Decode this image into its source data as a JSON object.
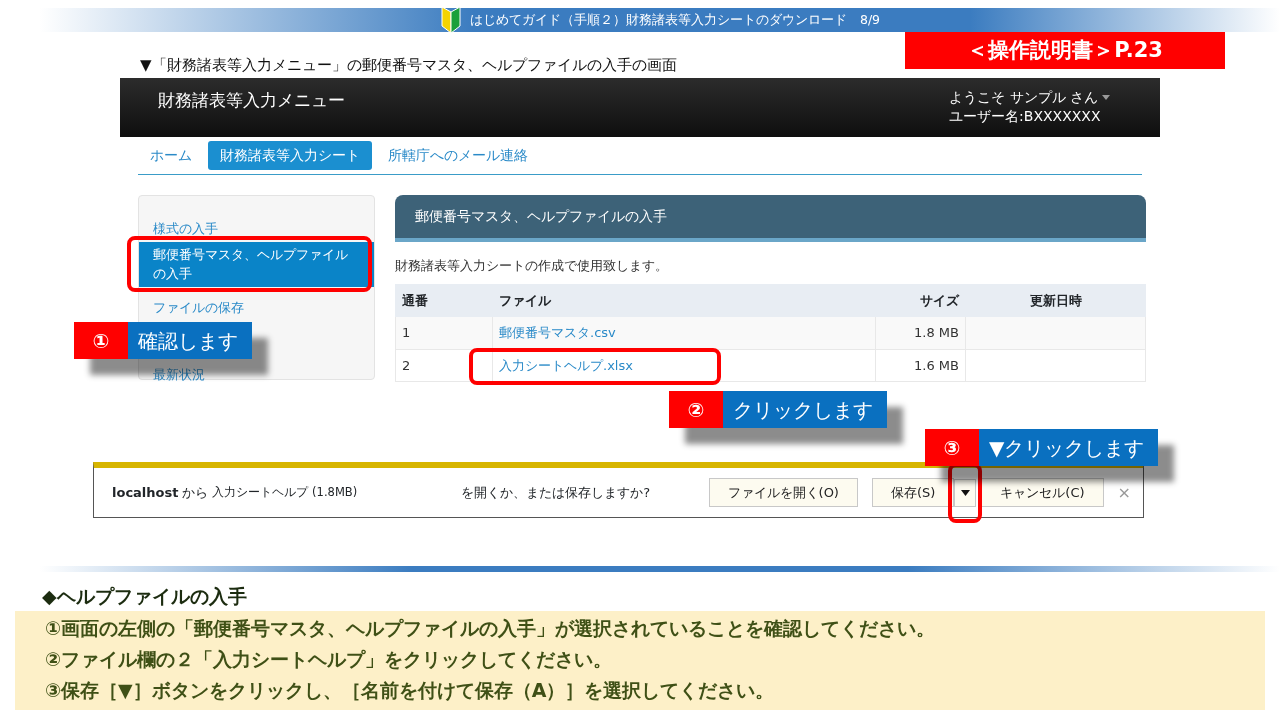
{
  "slide": {
    "header": "はじめてガイド（手順２）財務諸表等入力シートのダウンロード　8/9",
    "manual_ref": "＜操作説明書＞P.23",
    "caption": "▼「財務諸表等入力メニュー」の郵便番号マスタ、ヘルプファイルの入手の画面"
  },
  "app": {
    "brand": "財務諸表等入力メニュー",
    "user_greeting": "ようこそ サンプル さん",
    "user_name": "ユーザー名:BXXXXXXX",
    "tabs": [
      {
        "label": "ホーム",
        "selected": false
      },
      {
        "label": "財務諸表等入力シート",
        "selected": true
      },
      {
        "label": "所轄庁へのメール連絡",
        "selected": false
      }
    ],
    "sidebar": {
      "items": [
        {
          "label": "様式の入手",
          "selected": false
        },
        {
          "label": "郵便番号マスタ、ヘルプファイルの入手",
          "selected": true
        },
        {
          "label": "ファイルの保存",
          "selected": false
        },
        {
          "label": "最新状況",
          "selected": false
        }
      ]
    },
    "panel": {
      "title": "郵便番号マスタ、ヘルプファイルの入手",
      "description": "財務諸表等入力シートの作成で使用致します。"
    },
    "table": {
      "columns": [
        "通番",
        "ファイル",
        "サイズ",
        "更新日時"
      ],
      "rows": [
        {
          "number": "1",
          "file": "郵便番号マスタ.csv",
          "size": "1.8 MB"
        },
        {
          "number": "2",
          "file": "入力シートヘルプ.xlsx",
          "size": "1.6 MB"
        }
      ]
    }
  },
  "download_bar": {
    "source": "localhost",
    "from": "から",
    "file": "入力シートヘルプ (1.8MB)",
    "question": "を開くか、または保存しますか?",
    "open_button": "ファイルを開く(O)",
    "save_button": "保存(S)",
    "cancel_button": "キャンセル(C)",
    "close": "×"
  },
  "callouts": [
    {
      "number": "①",
      "text": "確認します"
    },
    {
      "number": "②",
      "text": "クリックします"
    },
    {
      "number": "③",
      "text": "▼クリックします"
    }
  ],
  "instructions": {
    "title": "◆ヘルプファイルの入手",
    "steps": [
      "①画面の左側の「郵便番号マスタ、ヘルプファイルの入手」が選択されていることを確認してください。",
      "②ファイル欄の２「入力シートヘルプ」をクリックしてください。",
      "③保存［▼］ボタンをクリックし、［名前を付けて保存（A）］を選択してください。"
    ]
  }
}
